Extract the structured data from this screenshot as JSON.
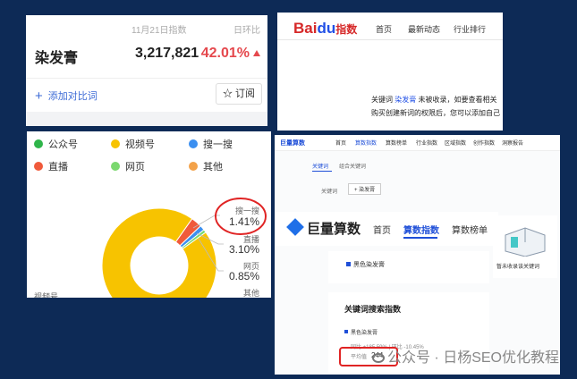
{
  "panel_a": {
    "date": "11月21日指数",
    "change_label": "日环比",
    "keyword": "染发膏",
    "index_value": "3,217,821",
    "change_pct": "42.01%",
    "add_compare": "添加对比词",
    "subscribe": "订阅",
    "colors": {
      "up": "#e5484d",
      "link": "#3d6bd6"
    }
  },
  "panel_b": {
    "logo_red": "Bai",
    "logo_blue": "du",
    "logo_tail": "指数",
    "nav": [
      "首页",
      "最新动态",
      "行业排行"
    ],
    "msg_line1_pre": "关键词 ",
    "msg_keyword": "染发膏",
    "msg_line1_post": " 未被收录，如要查看相关",
    "msg_line2": "购买创建新词的权限后，您可以添加自己"
  },
  "panel_c": {
    "legend": [
      {
        "label": "公众号",
        "color": "#2fb54a"
      },
      {
        "label": "视频号",
        "color": "#f7c300"
      },
      {
        "label": "搜一搜",
        "color": "#3b8ff0"
      },
      {
        "label": "直播",
        "color": "#f05a3b"
      },
      {
        "label": "网页",
        "color": "#7bd86f"
      },
      {
        "label": "其他",
        "color": "#f3a24a"
      }
    ],
    "callouts": [
      {
        "name": "搜一搜",
        "value": "1.41%"
      },
      {
        "name": "直播",
        "value": "3.10%"
      },
      {
        "name": "网页",
        "value": "0.85%"
      },
      {
        "name": "其他",
        "value": ""
      }
    ],
    "bottom_label": "视频号"
  },
  "chart_data": {
    "type": "pie",
    "categories": [
      "视频号",
      "直播",
      "搜一搜",
      "网页",
      "其他"
    ],
    "values": [
      94.64,
      3.1,
      1.41,
      0.85,
      0
    ],
    "colors": [
      "#f7c300",
      "#f05a3b",
      "#3b8ff0",
      "#7bd86f",
      "#f3a24a"
    ]
  },
  "panel_d": {
    "brand": "巨量算数",
    "top_nav": [
      "首页",
      "算数指数",
      "算数榜单",
      "行业指数",
      "区域指数",
      "创作指数",
      "洞察报告"
    ],
    "sub_tabs": [
      "关键词",
      "组合关键词"
    ],
    "keyword_label": "关键词",
    "add_keyword": "+ 染发膏",
    "big_nav": [
      "首页",
      "算数指数",
      "算数榜单"
    ],
    "chip": "黑色染发膏",
    "empty_note": "暂未收录该关键词",
    "section_title": "关键词搜索指数",
    "item": "黑色染发膏",
    "stat": "同比 +185.59% | 环比 -10.45%",
    "avg_label": "平均值",
    "avg_value": "244"
  },
  "watermark": {
    "text": "公众号 · 日杨SEO优化教程"
  }
}
